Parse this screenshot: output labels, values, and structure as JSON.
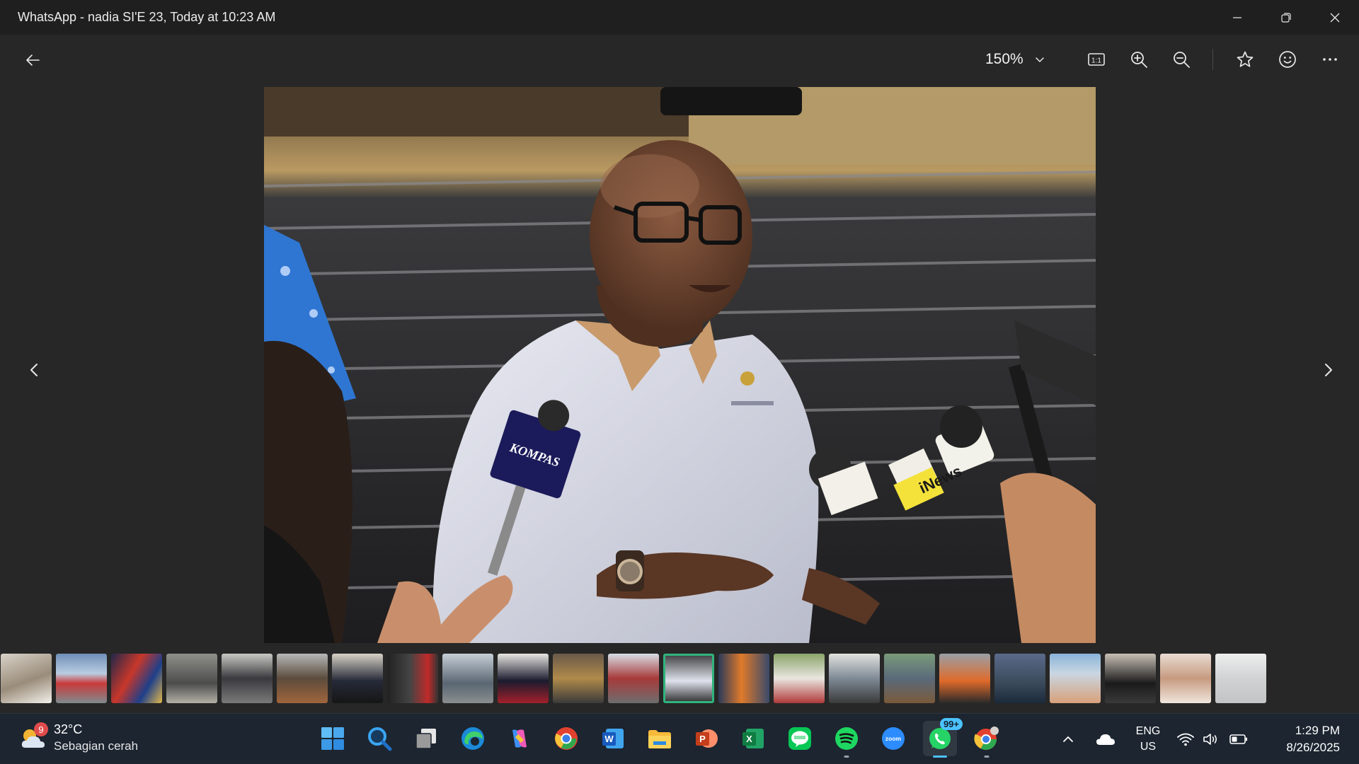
{
  "window": {
    "title": "WhatsApp - nadia SI'E 23, Today at 10:23 AM"
  },
  "toolbar": {
    "zoom_level": "150%",
    "actual_size_label": "1:1"
  },
  "icons": {
    "back": "back-arrow-icon",
    "zoom_dropdown": "chevron-down-icon",
    "actual_size": "actual-size-icon",
    "zoom_in": "zoom-in-icon",
    "zoom_out": "zoom-out-icon",
    "favorite": "star-icon",
    "react": "smiley-icon",
    "more": "more-icon"
  },
  "photo": {
    "mic_brand_1": "KOMPAS",
    "mic_brand_2": "iNews"
  },
  "filmstrip": {
    "count": 23,
    "active_index": 12
  },
  "taskbar": {
    "weather": {
      "badge": "9",
      "temp": "32°C",
      "condition": "Sebagian cerah"
    },
    "apps": [
      {
        "name": "start",
        "active": false,
        "running": false
      },
      {
        "name": "search",
        "active": false,
        "running": false
      },
      {
        "name": "task-view",
        "active": false,
        "running": false
      },
      {
        "name": "edge",
        "active": false,
        "running": false
      },
      {
        "name": "copilot",
        "active": false,
        "running": false
      },
      {
        "name": "chrome",
        "active": false,
        "running": false
      },
      {
        "name": "word",
        "active": false,
        "running": false
      },
      {
        "name": "file-explorer",
        "active": false,
        "running": false
      },
      {
        "name": "powerpoint",
        "active": false,
        "running": false
      },
      {
        "name": "excel",
        "active": false,
        "running": false
      },
      {
        "name": "line",
        "active": false,
        "running": false
      },
      {
        "name": "spotify",
        "active": false,
        "running": true
      },
      {
        "name": "zoom",
        "active": false,
        "running": false
      },
      {
        "name": "whatsapp",
        "active": true,
        "running": true
      },
      {
        "name": "chrome-profile",
        "active": false,
        "running": true
      }
    ],
    "whatsapp_badge": "99+",
    "zoom_label": "zoom",
    "lang_line1": "ENG",
    "lang_line2": "US",
    "time": "1:29 PM",
    "date": "8/26/2025"
  },
  "colors": {
    "accent": "#4cc2ff",
    "active_thumb": "#2fb47d",
    "taskbar": "#1c2530"
  }
}
